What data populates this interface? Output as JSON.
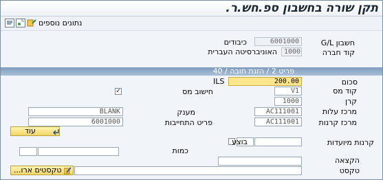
{
  "title": "תקן שורה בחשבון ספ.חש.ר.",
  "toolbar": {
    "more_data_label": "נתונים נוספים"
  },
  "header": {
    "gl_account_label": "חשבון G/L",
    "gl_account_value": "6001000",
    "gl_account_desc": "כיבודים",
    "company_code_label": "קוד חברה",
    "company_code_value": "1000",
    "company_code_desc": "האוניברסיטה העברית"
  },
  "section": {
    "title": "פריט 2 / הזנת חובה / 40"
  },
  "form": {
    "amount_label": "סכום",
    "amount_value": "200.00",
    "currency": "ILS",
    "tax_code_label": "קוד מס",
    "tax_code_value": "V1",
    "calc_tax_label": "חישוב מס",
    "calc_tax_checked": "✓",
    "fund_label": "קרן",
    "fund_value": "1000",
    "cost_center_label": "מרכז עלות",
    "cost_center_value": "AC111001",
    "grant_label": "מענק",
    "grant_value": "BLANK",
    "funds_center_label": "מרכז קרנות",
    "funds_center_value": "AC111001",
    "commitment_item_label": "פריט התחייבות",
    "commitment_item_value": "6001000",
    "more_button_label": "עוד",
    "earmarked_funds_label": "קרנות מיועדות",
    "done_label": "בוצע",
    "quantity_label": "כמות",
    "assignment_label": "הקצאה",
    "text_label": "טקסט",
    "long_texts_button_label": "טקסטים ארו..."
  },
  "colors": {
    "highlight": "#ffe58c",
    "section_bar": "#8fa9c8",
    "button": "#f3d66b"
  },
  "icons": [
    "display-icon",
    "new-document-icon",
    "more-data-icon",
    "more-arrow-icon",
    "long-text-pencil-icon"
  ]
}
